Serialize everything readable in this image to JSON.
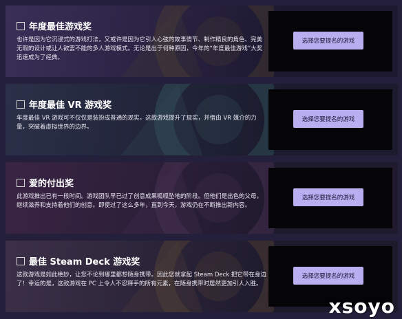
{
  "cards": [
    {
      "title": "年度最佳游戏奖",
      "description": "也许是因为它沉浸式的游戏打法，又或许是因为它引人心弦的故事情节、制作精良的角色、完美无瑕的设计或让人欲罢不能的多人游戏模式。无论是出于何种原因，今年的“年度最佳游戏”大奖迅速成为了经典。",
      "button": "选择您要提名的游戏",
      "colors": {
        "from": "#3a2f58",
        "to": "#1d1930",
        "accent": "#5b4b2e"
      }
    },
    {
      "title": "年度最佳 VR 游戏奖",
      "description": "年度最佳 VR 游戏可不仅仅是装扮成普通的现实。这款游戏提升了现实，并借由 VR 媒介的力量，突破着虚拟世界的边界。",
      "button": "选择您要提名的游戏",
      "colors": {
        "from": "#2b3048",
        "to": "#1a1b2d",
        "accent": "#3e6a6e"
      }
    },
    {
      "title": "爱的付出奖",
      "description": "此游戏推出已有一段时间。游戏团队早已过了创意成果呱呱坠地的阶段。但他们是出色的父母，继续滋养和支持着他们的创意。即使过了这么多年，直到今天，游戏仍在不断推出新内容。",
      "button": "选择您要提名的游戏",
      "colors": {
        "from": "#3a2444",
        "to": "#1f1a2e",
        "accent": "#5b3a63"
      }
    },
    {
      "title": "最佳 Steam Deck 游戏奖",
      "description": "这款游戏是如此绝妙，让您不论到哪里都想随身携带。因此您就拿起 Steam Deck 把它带在身边了！幸运的是，这款游戏在 PC 上令人不忍释手的所有元素，在随身携带时居然更加引人入胜。",
      "button": "选择您要提名的游戏",
      "colors": {
        "from": "#3c3048",
        "to": "#1d1a2c",
        "accent": "#6a5236"
      }
    }
  ],
  "watermark": "xsoyo"
}
